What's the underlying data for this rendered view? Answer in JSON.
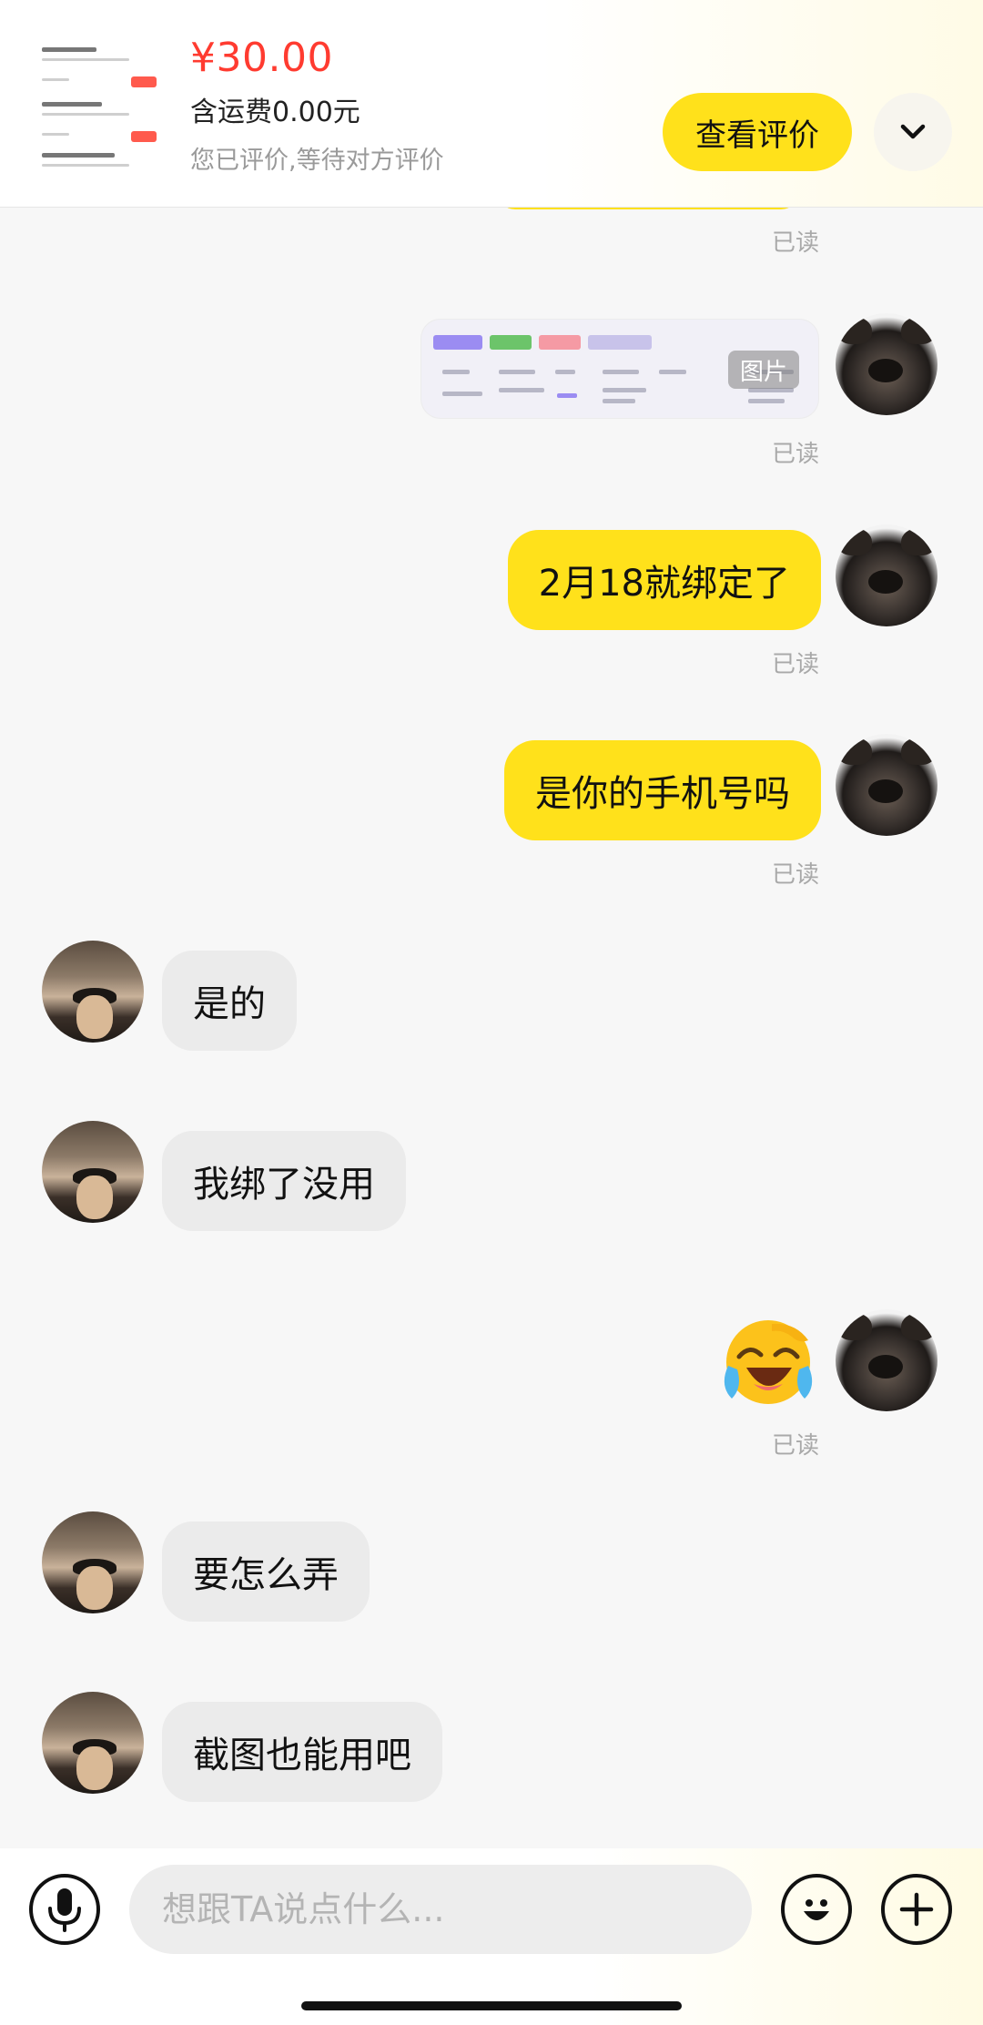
{
  "order": {
    "price": "¥30.00",
    "shipping": "含运费0.00元",
    "review_status": "您已评价,等待对方评价",
    "view_review_label": "查看评价",
    "collapse_icon": "chevron-down-icon"
  },
  "messages": [
    {
      "side": "me",
      "type": "image",
      "badge": "图片",
      "read": "已读"
    },
    {
      "side": "me",
      "type": "text",
      "text": "2月18就绑定了",
      "read": "已读"
    },
    {
      "side": "me",
      "type": "text",
      "text": "是你的手机号吗",
      "read": "已读"
    },
    {
      "side": "other",
      "type": "text",
      "text": "是的"
    },
    {
      "side": "other",
      "type": "text",
      "text": "我绑了没用"
    },
    {
      "side": "me",
      "type": "emoji",
      "emoji": "laughing-crying-emoji",
      "read": "已读"
    },
    {
      "side": "other",
      "type": "text",
      "text": "要怎么弄"
    },
    {
      "side": "other",
      "type": "text",
      "text": "截图也能用吧"
    }
  ],
  "first_read_label": "已读",
  "input": {
    "placeholder": "想跟TA说点什么...",
    "value": ""
  },
  "icons": {
    "voice": "microphone-icon",
    "emoji": "emoji-face-icon",
    "plus": "plus-icon"
  },
  "colors": {
    "accent": "#ffe11b",
    "price": "#ff3b30",
    "other_bubble": "#ebebeb",
    "read_text": "#a9a9a9"
  }
}
